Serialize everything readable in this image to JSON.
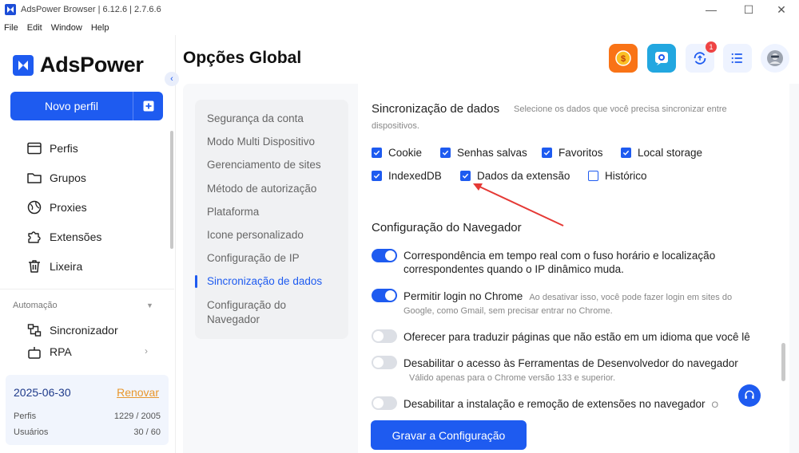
{
  "window": {
    "title": "AdsPower Browser | 6.12.6 | 2.7.6.6",
    "minimize": "—",
    "maximize": "☐",
    "close": "✕"
  },
  "menu": [
    "File",
    "Edit",
    "Window",
    "Help"
  ],
  "sidebar": {
    "brand": "AdsPower",
    "new_profile": "Novo perfil",
    "items": [
      {
        "label": "Perfis",
        "icon": "browser-window-icon"
      },
      {
        "label": "Grupos",
        "icon": "folder-icon"
      },
      {
        "label": "Proxies",
        "icon": "globe-icon"
      },
      {
        "label": "Extensões",
        "icon": "puzzle-icon"
      },
      {
        "label": "Lixeira",
        "icon": "trash-icon"
      }
    ],
    "section": "Automação",
    "automation_items": [
      {
        "label": "Sincronizador",
        "icon": "sync-icon"
      },
      {
        "label": "RPA",
        "icon": "robot-icon"
      }
    ],
    "plan": {
      "date": "2025-06-30",
      "renew": "Renovar",
      "profiles_label": "Perfis",
      "profiles_value": "1229 / 2005",
      "users_label": "Usuários",
      "users_value": "30 / 60"
    }
  },
  "header": {
    "title": "Opções Global",
    "notification_count": "1",
    "icons": [
      "coin-icon",
      "chat-icon",
      "sync-icon",
      "list-icon",
      "avatar-icon"
    ]
  },
  "settings_nav": {
    "items": [
      "Segurança da conta",
      "Modo Multi Dispositivo",
      "Gerenciamento de sites",
      "Método de autorização",
      "Plataforma",
      "Icone personalizado",
      "Configuração de IP",
      "Sincronização de dados",
      "Configuração do",
      "Navegador"
    ],
    "active_index": 7
  },
  "sync": {
    "title": "Sincronização de dados",
    "hint_line1": "Selecione os dados que você precisa sincronizar entre",
    "hint_line2": "dispositivos.",
    "options": [
      {
        "label": "Cookie",
        "checked": true
      },
      {
        "label": "Senhas salvas",
        "checked": true
      },
      {
        "label": "Favoritos",
        "checked": true
      },
      {
        "label": "Local storage",
        "checked": true
      },
      {
        "label": "IndexedDB",
        "checked": true
      },
      {
        "label": "Dados da extensão",
        "checked": true
      },
      {
        "label": "Histórico",
        "checked": false
      }
    ]
  },
  "browser_config": {
    "title": "Configuração do Navegador",
    "options": [
      {
        "line1": "Correspondência em tempo real com o fuso horário e localização",
        "line2": "correspondentes quando o IP dinâmico muda.",
        "on": true
      },
      {
        "line1": "Permitir login no Chrome",
        "hint1": "Ao desativar isso, você pode fazer login em sites do",
        "hint2": "Google, como Gmail, sem precisar entrar no Chrome.",
        "on": true
      },
      {
        "line1": "Oferecer para traduzir páginas que não estão em um idioma que você lê",
        "on": false
      },
      {
        "line1": "Desabilitar o acesso às Ferramentas de Desenvolvedor do navegador",
        "hint2": "Válido apenas para o Chrome versão 133 e superior.",
        "on": false
      },
      {
        "line1": "Desabilitar a instalação e remoção de extensões no navegador",
        "hint1": "O",
        "on": false
      }
    ]
  },
  "save_button": "Gravar a Configuração",
  "colors": {
    "accent": "#1e5bf0",
    "renew": "#e8962c",
    "arrow": "#e53935"
  }
}
